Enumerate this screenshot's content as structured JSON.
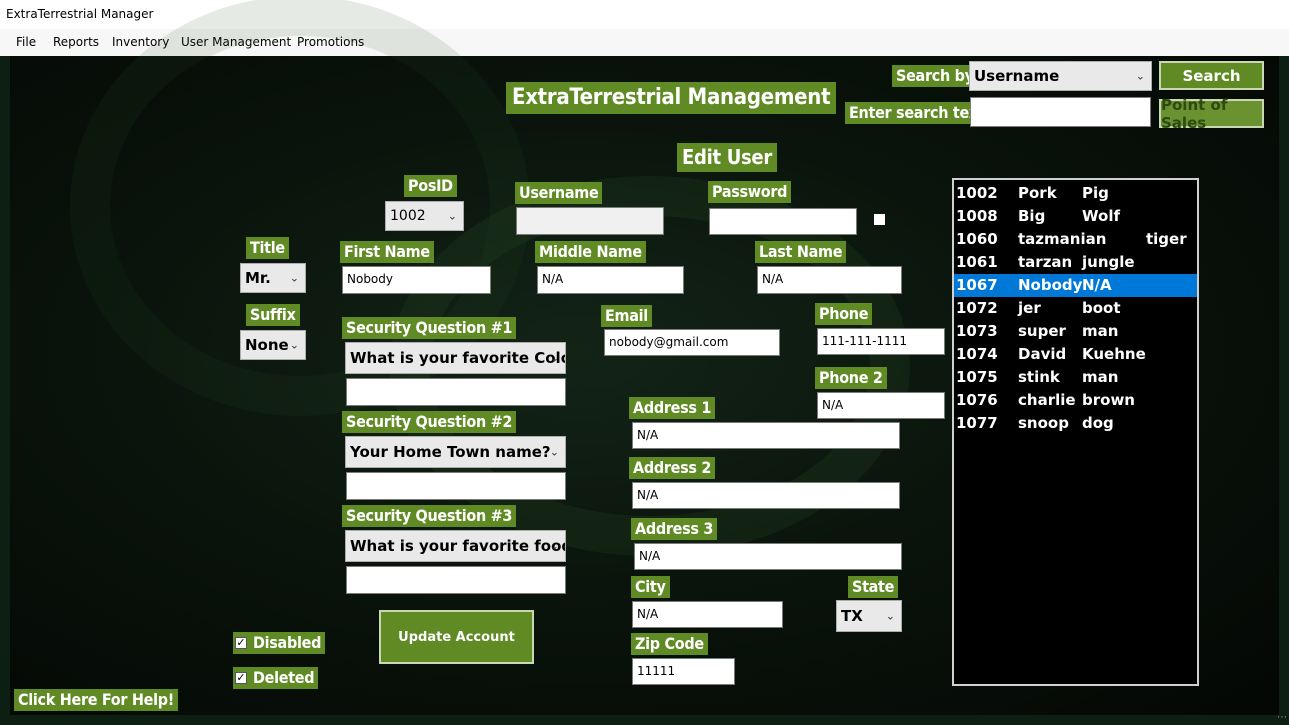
{
  "window": {
    "title": "ExtraTerrestrial Manager"
  },
  "menu": {
    "items": [
      "File",
      "Reports",
      "Inventory",
      "User Management",
      "Promotions"
    ]
  },
  "header": {
    "title": "ExtraTerrestrial Management",
    "subtitle": "Edit User"
  },
  "search": {
    "by_label": "Search by:",
    "by_value": "Username",
    "text_label": "Enter search text:",
    "text_value": "",
    "search_button": "Search",
    "pos_button": "Point of Sales"
  },
  "form": {
    "posid_label": "PosID",
    "posid_value": "1002",
    "username_label": "Username",
    "username_value": "",
    "password_label": "Password",
    "password_value": "",
    "title_label": "Title",
    "title_value": "Mr.",
    "suffix_label": "Suffix",
    "suffix_value": "None",
    "first_name_label": "First Name",
    "first_name_value": "Nobody",
    "middle_name_label": "Middle Name",
    "middle_name_value": "N/A",
    "last_name_label": "Last Name",
    "last_name_value": "N/A",
    "email_label": "Email",
    "email_value": "nobody@gmail.com",
    "phone_label": "Phone",
    "phone_value": "111-111-1111",
    "phone2_label": "Phone 2",
    "phone2_value": "N/A",
    "sq1_label": "Security Question #1",
    "sq1_value": "What is your favorite Color?",
    "sa1_value": "",
    "sq2_label": "Security Question #2",
    "sq2_value": "Your Home Town name?",
    "sa2_value": "",
    "sq3_label": "Security Question #3",
    "sq3_value": "What is your favorite food?",
    "sa3_value": "",
    "address1_label": "Address 1",
    "address1_value": "N/A",
    "address2_label": "Address 2",
    "address2_value": "N/A",
    "address3_label": "Address 3",
    "address3_value": "N/A",
    "city_label": "City",
    "city_value": "N/A",
    "state_label": "State",
    "state_value": "TX",
    "zip_label": "Zip Code",
    "zip_value": "11111",
    "update_button": "Update Account",
    "disabled_label": "Disabled",
    "disabled_checked": true,
    "deleted_label": "Deleted",
    "deleted_checked": true,
    "help_label": "Click Here For Help!"
  },
  "user_list": {
    "rows": [
      {
        "id": "1002",
        "first": "Pork",
        "last": "Pig"
      },
      {
        "id": "1008",
        "first": "Big",
        "last": "Wolf"
      },
      {
        "id": "1060",
        "first": "tazmanian",
        "last": "tiger"
      },
      {
        "id": "1061",
        "first": "tarzan",
        "last": "jungle"
      },
      {
        "id": "1067",
        "first": "Nobody",
        "last": "N/A"
      },
      {
        "id": "1072",
        "first": "jer",
        "last": "boot"
      },
      {
        "id": "1073",
        "first": "super",
        "last": "man"
      },
      {
        "id": "1074",
        "first": "David",
        "last": "Kuehne"
      },
      {
        "id": "1075",
        "first": "stink",
        "last": "man"
      },
      {
        "id": "1076",
        "first": "charlie",
        "last": "brown"
      },
      {
        "id": "1077",
        "first": "snoop",
        "last": "dog"
      }
    ],
    "selected_index": 4
  },
  "colors": {
    "label_green": "#5f8a24",
    "selection_blue": "#0078d7"
  }
}
